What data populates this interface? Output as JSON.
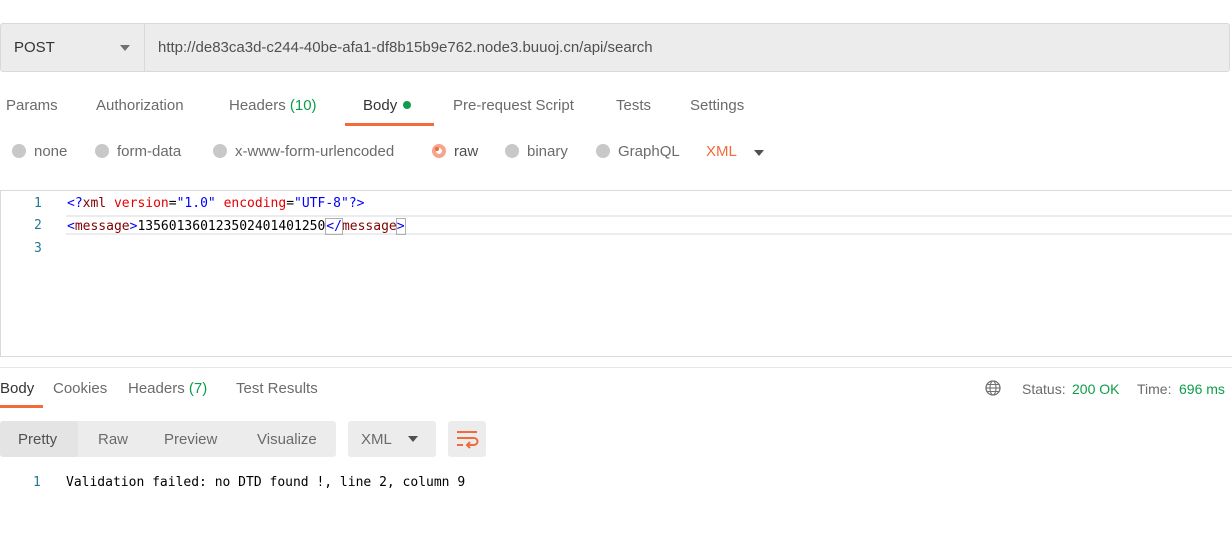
{
  "request": {
    "method": "POST",
    "url": "http://de83ca3d-c244-40be-afa1-df8b15b9e762.node3.buuoj.cn/api/search"
  },
  "request_tabs": [
    {
      "label": "Params"
    },
    {
      "label": "Authorization"
    },
    {
      "label": "Headers",
      "count": "(10)"
    },
    {
      "label": "Body",
      "active": true
    },
    {
      "label": "Pre-request Script"
    },
    {
      "label": "Tests"
    },
    {
      "label": "Settings"
    }
  ],
  "body_types": [
    "none",
    "form-data",
    "x-www-form-urlencoded",
    "raw",
    "binary",
    "GraphQL"
  ],
  "body_type_selected": "raw",
  "body_language": "XML",
  "editor": {
    "line_numbers": [
      "1",
      "2",
      "3"
    ],
    "line1": {
      "open": "<?",
      "name": "xml",
      "attr1": "version",
      "eq1": "=",
      "val1": "\"1.0\"",
      "attr2": "encoding",
      "eq2": "=",
      "val2": "\"UTF-8\"",
      "close": "?>"
    },
    "line2": {
      "lt": "<",
      "tag": "message",
      "gt": ">",
      "text": "13560136012350240140125",
      "text_last": "0",
      "end_lt": "</",
      "end_tag": "message",
      "end_gt": ">"
    }
  },
  "response_tabs": [
    {
      "label": "Body",
      "active": true
    },
    {
      "label": "Cookies"
    },
    {
      "label": "Headers",
      "count": "(7)"
    },
    {
      "label": "Test Results"
    }
  ],
  "response_status": {
    "status_label": "Status:",
    "status_value": "200 OK",
    "time_label": "Time:",
    "time_value": "696 ms"
  },
  "response_views": [
    "Pretty",
    "Raw",
    "Preview",
    "Visualize"
  ],
  "response_view_active": "Pretty",
  "response_format": "XML",
  "response_body": {
    "line_number": "1",
    "text": "Validation failed: no DTD found !, line 2, column 9"
  },
  "colors": {
    "accent": "#f26b3a",
    "success": "#0d9d4a"
  },
  "icons": [
    "chevron-down-icon",
    "globe-icon",
    "wrap-lines-icon"
  ]
}
